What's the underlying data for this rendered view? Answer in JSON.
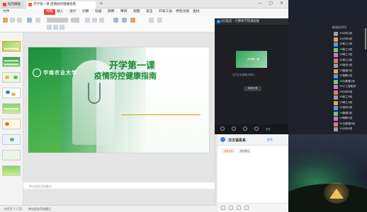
{
  "wps": {
    "app_tab": "稻壳模板",
    "doc_tab": "开学第一课-疫情防控健康指南",
    "menu": [
      "文件",
      "开始",
      "插入",
      "设计",
      "切换",
      "动画",
      "放映",
      "审阅",
      "视图",
      "安全",
      "开发工具",
      "特色功能",
      "查找"
    ],
    "active_menu": "开始",
    "slide": {
      "university": "华南农业大学",
      "title_line1": "开学第一课",
      "title_line2": "疫情防控健康指南"
    },
    "notes_placeholder": "单击此处添加备注",
    "status": {
      "left": "幻灯片 1 / 23",
      "mid": "单击此处添加备注",
      "zoom": "60%"
    }
  },
  "qq": {
    "title": "QQ电话 - 计算机学院课程群",
    "share_card_text": "开学第一课",
    "share_caption": "对方正在屏幕共享中",
    "share_button": "申请分享",
    "cam_label": "视频",
    "cam_name": "教师",
    "controls": [
      "静音",
      "视频",
      "共享",
      "更多"
    ],
    "end_button": "挂断"
  },
  "chat": {
    "name": "汉汉语系系",
    "more": "更多",
    "tags": [
      "分享文件",
      "邀请群友"
    ]
  },
  "members": {
    "title": "群成员(83)",
    "list": [
      "19计科1班",
      "19计科2班",
      "19软工1班",
      "19软工2班",
      "19网工1班",
      "19网工2班",
      "19信安1班",
      "19数媒1班",
      "19物联1班",
      "19大数据1班",
      "19人工智能班",
      "19计科3班",
      "19软工3班",
      "19网工3班",
      "19信安2班",
      "19数媒2班",
      "19物联2班",
      "19大数据2班",
      "19计科4班"
    ]
  }
}
